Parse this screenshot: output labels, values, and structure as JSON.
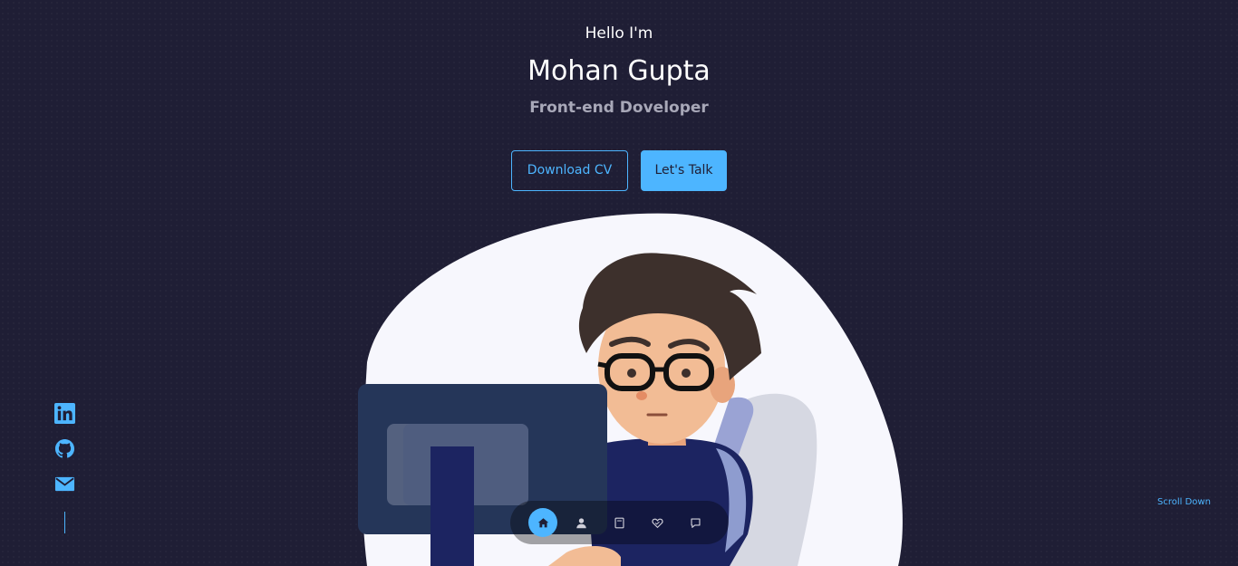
{
  "hero": {
    "greeting": "Hello I'm",
    "name": "Mohan Gupta",
    "role": "Front-end Doveloper"
  },
  "buttons": {
    "download_cv": "Download CV",
    "lets_talk": "Let's Talk"
  },
  "socials": [
    {
      "name": "linkedin",
      "icon": "linkedin-icon"
    },
    {
      "name": "github",
      "icon": "github-icon"
    },
    {
      "name": "email",
      "icon": "mail-icon"
    }
  ],
  "scroll_down": "Scroll Down",
  "bottom_nav": {
    "items": [
      {
        "name": "home",
        "icon": "home-icon",
        "active": true
      },
      {
        "name": "about",
        "icon": "user-icon",
        "active": false
      },
      {
        "name": "experience",
        "icon": "book-icon",
        "active": false
      },
      {
        "name": "services",
        "icon": "handshake-icon",
        "active": false
      },
      {
        "name": "contact",
        "icon": "message-icon",
        "active": false
      }
    ]
  },
  "colors": {
    "background": "#1f1e35",
    "accent": "#4db5ff",
    "text": "#ffffff",
    "muted_text": "#a8a8b8"
  }
}
